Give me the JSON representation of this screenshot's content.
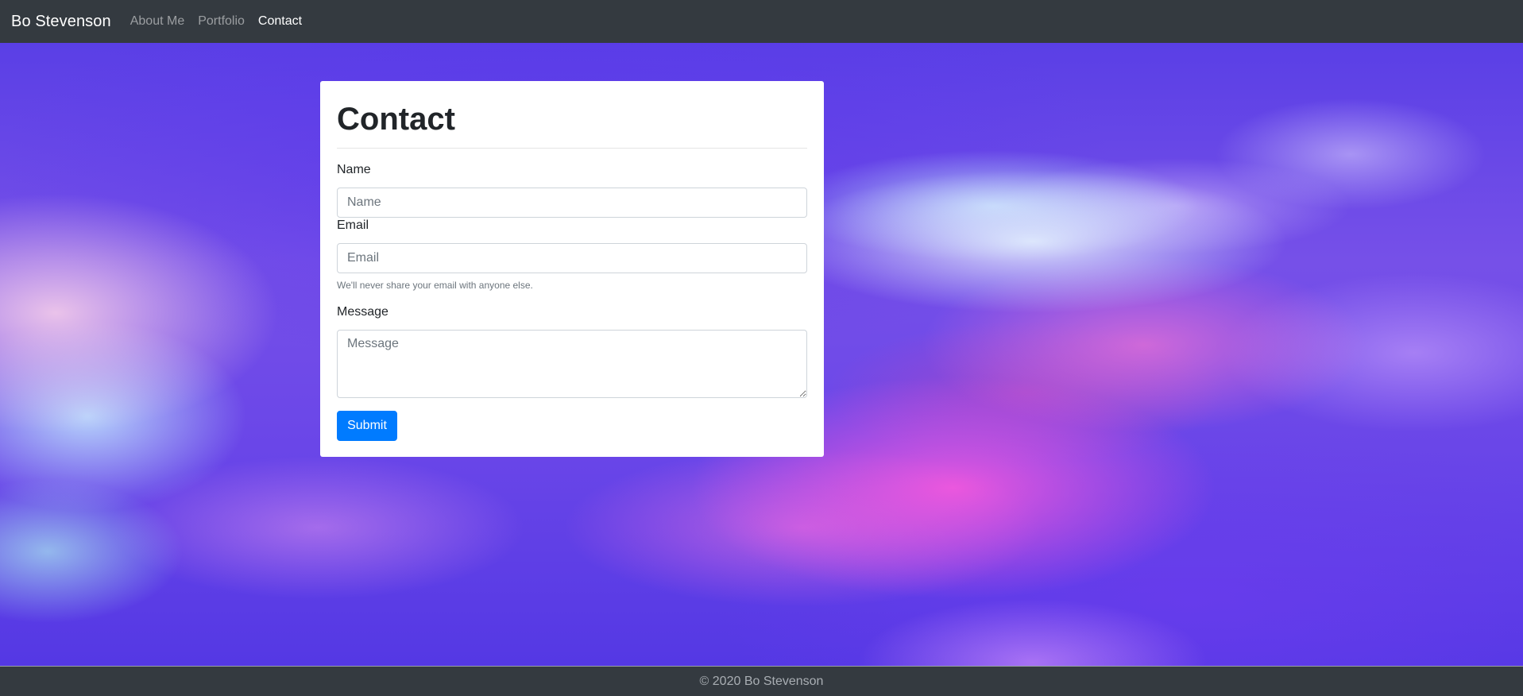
{
  "navbar": {
    "brand": "Bo Stevenson",
    "links": [
      {
        "label": "About Me",
        "active": false
      },
      {
        "label": "Portfolio",
        "active": false
      },
      {
        "label": "Contact",
        "active": true
      }
    ]
  },
  "contact_form": {
    "title": "Contact",
    "name": {
      "label": "Name",
      "placeholder": "Name",
      "value": ""
    },
    "email": {
      "label": "Email",
      "placeholder": "Email",
      "value": "",
      "help": "We'll never share your email with anyone else."
    },
    "message": {
      "label": "Message",
      "placeholder": "Message",
      "value": ""
    },
    "submit_label": "Submit"
  },
  "footer": {
    "text": "© 2020 Bo Stevenson"
  },
  "colors": {
    "navbar_bg": "#343a40",
    "primary_button": "#007bff",
    "card_bg": "#ffffff"
  }
}
